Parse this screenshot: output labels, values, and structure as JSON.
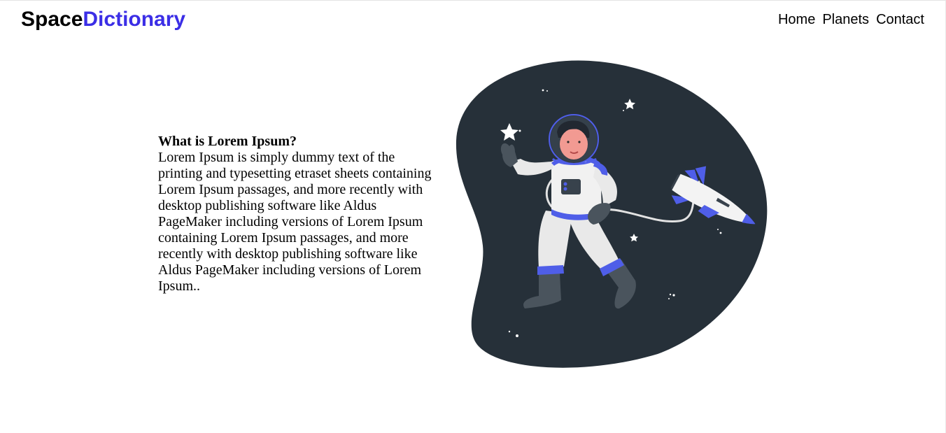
{
  "header": {
    "logo_part1": "Space",
    "logo_part2": "Dictionary",
    "nav": {
      "home": "Home",
      "planets": "Planets",
      "contact": "Contact"
    }
  },
  "main": {
    "heading": "What is Lorem Ipsum?",
    "body": "Lorem Ipsum is simply dummy text of the printing and typesetting etraset sheets containing Lorem Ipsum passages, and more recently with desktop publishing software like Aldus PageMaker including versions of Lorem Ipsum containing Lorem Ipsum passages, and more recently with desktop publishing software like Aldus PageMaker including versions of Lorem Ipsum.."
  },
  "colors": {
    "accent": "#3b2ee6",
    "blob": "#263039",
    "suit_accent": "#4f5ee8"
  },
  "illustration": {
    "icon": "astronaut-rocket-illustration"
  }
}
